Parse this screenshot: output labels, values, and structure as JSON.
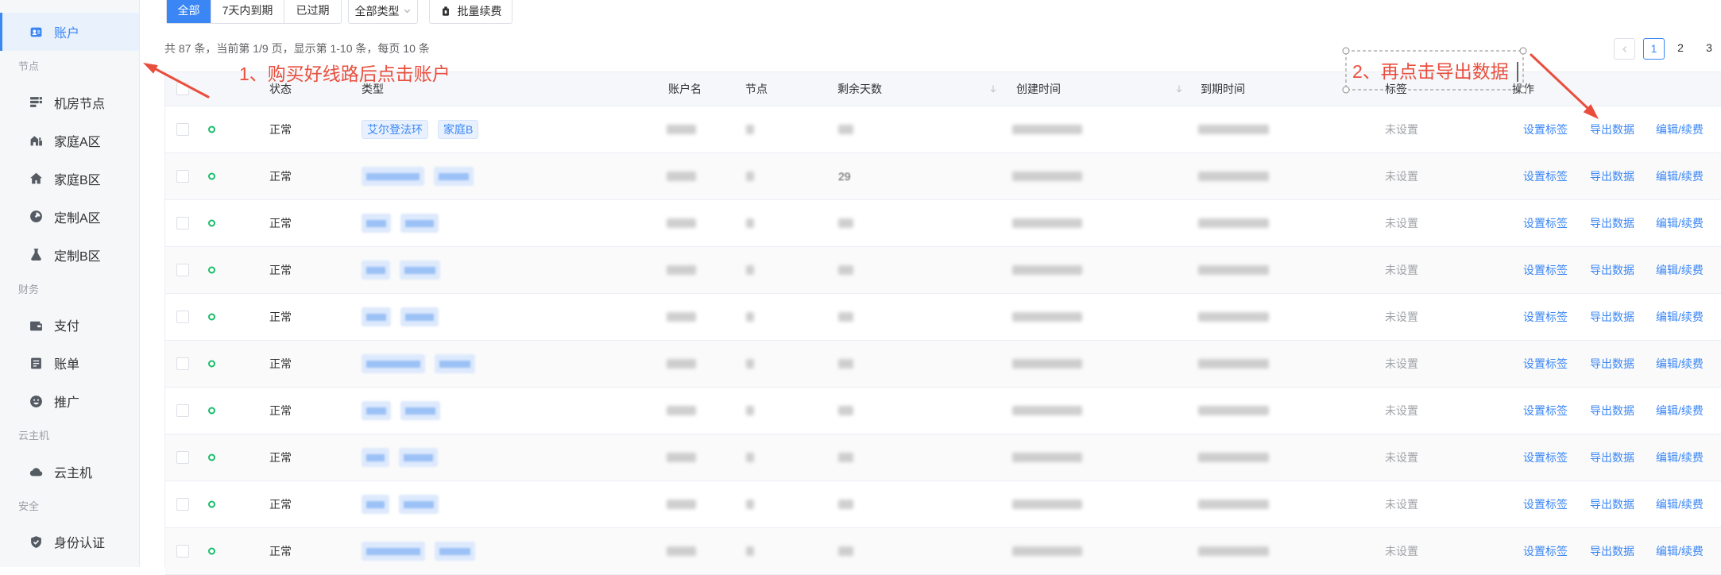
{
  "colors": {
    "primary": "#3a86f5",
    "annotation": "#e94e3d",
    "status_ok": "#19be6b"
  },
  "sidebar": {
    "account": {
      "label": "账户",
      "icon": "account-card-icon",
      "active": true
    },
    "groups": [
      {
        "title": "节点",
        "items": [
          {
            "label": "机房节点",
            "icon": "server-rack-icon"
          },
          {
            "label": "家庭A区",
            "icon": "building-icon"
          },
          {
            "label": "家庭B区",
            "icon": "home-icon"
          },
          {
            "label": "定制A区",
            "icon": "compass-icon"
          },
          {
            "label": "定制B区",
            "icon": "flask-icon"
          }
        ]
      },
      {
        "title": "财务",
        "items": [
          {
            "label": "支付",
            "icon": "wallet-icon"
          },
          {
            "label": "账单",
            "icon": "bill-icon"
          },
          {
            "label": "推广",
            "icon": "smile-icon"
          }
        ]
      },
      {
        "title": "云主机",
        "items": [
          {
            "label": "云主机",
            "icon": "cloud-icon"
          }
        ]
      },
      {
        "title": "安全",
        "items": [
          {
            "label": "身份认证",
            "icon": "shield-check-icon"
          }
        ]
      }
    ]
  },
  "toolbar": {
    "filters": [
      {
        "label": "全部",
        "active": true
      },
      {
        "label": "7天内到期",
        "active": false
      },
      {
        "label": "已过期",
        "active": false
      }
    ],
    "type_select": "全部类型",
    "batch_renew": "批量续费"
  },
  "summary": "共 87 条，当前第 1/9 页，显示第 1-10 条，每页 10 条",
  "pagination": {
    "pages": [
      "1",
      "2",
      "3"
    ],
    "current": "1"
  },
  "table": {
    "columns": {
      "status": "状态",
      "type": "类型",
      "account": "账户名",
      "node": "节点",
      "days": "剩余天数",
      "created": "创建时间",
      "expiry": "到期时间",
      "tag": "标签",
      "actions": "操作"
    },
    "actions": [
      "设置标签",
      "导出数据",
      "编辑/续费"
    ],
    "rows": [
      {
        "status": "正常",
        "tags": [
          "艾尔登法环",
          "家庭B"
        ],
        "days": "",
        "label": "未设置"
      },
      {
        "status": "正常",
        "tags": [],
        "days": "29",
        "label": "未设置"
      },
      {
        "status": "正常",
        "tags": [],
        "days": "",
        "label": "未设置"
      },
      {
        "status": "正常",
        "tags": [],
        "days": "",
        "label": "未设置"
      },
      {
        "status": "正常",
        "tags": [],
        "days": "",
        "label": "未设置"
      },
      {
        "status": "正常",
        "tags": [],
        "days": "",
        "label": "未设置"
      },
      {
        "status": "正常",
        "tags": [],
        "days": "",
        "label": "未设置"
      },
      {
        "status": "正常",
        "tags": [],
        "days": "",
        "label": "未设置"
      },
      {
        "status": "正常",
        "tags": [],
        "days": "",
        "label": "未设置"
      },
      {
        "status": "正常",
        "tags": [],
        "days": "",
        "label": "未设置"
      }
    ]
  },
  "annotations": {
    "step1": "1、购买好线路后点击账户",
    "step2": "2、再点击导出数据"
  }
}
